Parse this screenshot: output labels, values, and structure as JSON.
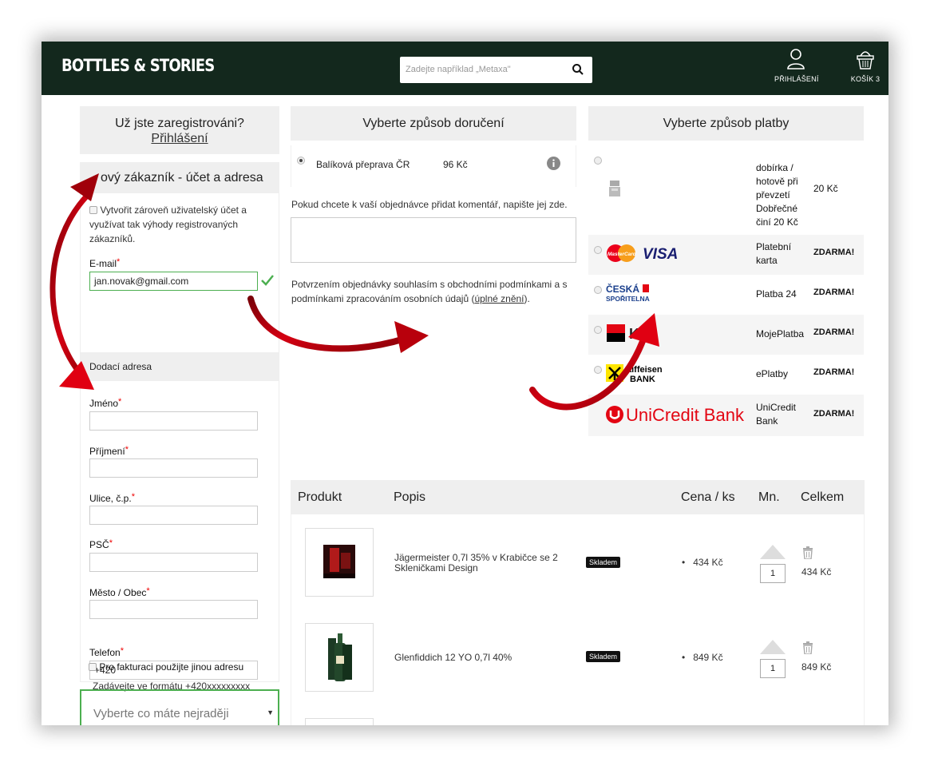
{
  "header": {
    "logo": "BOTTLES & STORIES",
    "search_placeholder": "Zadejte například „Metaxa\"",
    "login_label": "PŘIHLÁŠENÍ",
    "cart_label": "KOŠÍK 3"
  },
  "login_panel": {
    "question": "Už jste zaregistrováni?",
    "link": "Přihlášení"
  },
  "new_customer": {
    "title": "ový zákazník - účet a adresa",
    "create_account_text": "Vytvořit zároveň uživatelský účet a využívat tak výhody registrovaných zákazníků.",
    "email_label": "E-mail",
    "email_value": "jan.novak@gmail.com",
    "address_section": "Dodací adresa",
    "name_label": "Jméno",
    "surname_label": "Příjmení",
    "street_label": "Ulice, č.p.",
    "zip_label": "PSČ",
    "city_label": "Město / Obec",
    "phone_label": "Telefon",
    "phone_value": "+420",
    "phone_hint": "Zadávejte ve formátu +420xxxxxxxxx",
    "billing_checkbox": "Pro fakturaci použijte jinou adresu",
    "select_placeholder": "Vyberte co máte nejraději"
  },
  "shipping": {
    "title": "Vyberte způsob doručení",
    "option_name": "Balíková přeprava ČR",
    "option_price": "96 Kč",
    "comment_hint": "Pokud chcete k vaší objednávce přidat komentář, napište jej zde.",
    "terms_text": "Potvrzením objednávky souhlasím s obchodními podmínkami a s podmínkami zpracováním osobních údajů (",
    "terms_link": "úplné znění",
    "terms_end": ")."
  },
  "payment": {
    "title": "Vyberte způsob platby",
    "options": [
      {
        "name_lines": [
          "dobírka /",
          "hotově při",
          "převzetí",
          "Dobřečné",
          "činí 20 Kč"
        ],
        "price": "20 Kč",
        "logo": "cash-hand-icon"
      },
      {
        "name_lines": [
          "Platební",
          "karta"
        ],
        "price": "ZDARMA!",
        "logo": "mastercard-visa-logo",
        "logo_text": [
          "MasterCard",
          "VISA"
        ]
      },
      {
        "name_lines": [
          "Platba 24"
        ],
        "price": "ZDARMA!",
        "logo": "ceska-sporitelna-logo",
        "logo_text": [
          "ČESKÁ",
          "SPOŘITELNA"
        ]
      },
      {
        "name_lines": [
          "MojePlatba"
        ],
        "price": "ZDARMA!",
        "logo": "kb-logo",
        "logo_text": [
          "KB"
        ]
      },
      {
        "name_lines": [
          "ePlatby"
        ],
        "price": "ZDARMA!",
        "logo": "raiffeisen-logo",
        "logo_text": [
          "aiffeisen",
          "BANK"
        ]
      },
      {
        "name_lines": [
          "UniCredit",
          "Bank"
        ],
        "price": "ZDARMA!",
        "logo": "unicredit-logo",
        "logo_text": [
          "UniCredit Bank"
        ]
      }
    ]
  },
  "cart": {
    "headers": {
      "product": "Produkt",
      "description": "Popis",
      "unit_price": "Cena / ks",
      "qty": "Mn.",
      "total": "Celkem"
    },
    "items": [
      {
        "name_lines": [
          "Jägermeister 0,7l 35% v Krabičce se 2",
          "Skleničkami Design"
        ],
        "stock": "Skladem",
        "price": "434 Kč",
        "qty": "1",
        "total": "434 Kč"
      },
      {
        "name_lines": [
          "Glenfiddich 12 YO 0,7l 40%"
        ],
        "stock": "Skladem",
        "price": "849 Kč",
        "qty": "1",
        "total": "849 Kč"
      }
    ]
  },
  "colors": {
    "header_bg": "#13281d",
    "arrow_red": "#c8000a",
    "valid_green": "#4caf50"
  }
}
